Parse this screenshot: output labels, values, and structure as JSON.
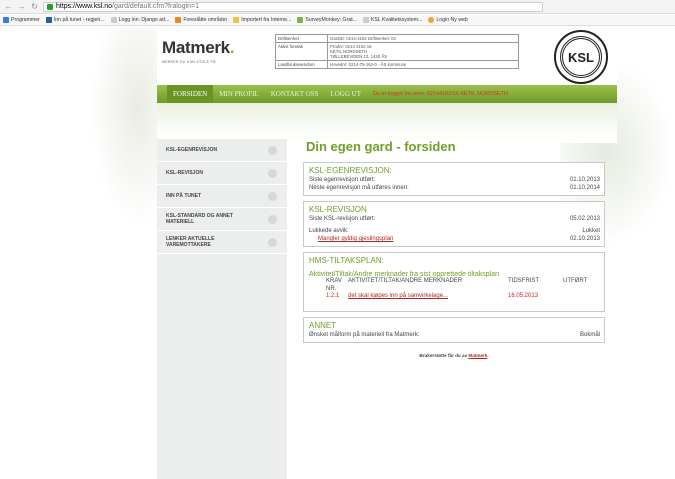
{
  "browser": {
    "url_host": "https://www.ksl.no",
    "url_path": "/gard/default.cfm?fralogin=1",
    "bookmarks": [
      "Programmer",
      "Inn på tunet - regjeri...",
      "Logg inn: Django ad...",
      "Foreslåtte områder",
      "Importert fra Interne...",
      "SurveyMonkey: Grat...",
      "KSL Kvalitetssystem...",
      "Login Ny web"
    ]
  },
  "header": {
    "logo_text": "Matmerk",
    "logo_dot": ".",
    "tagline": "MERKER DU KAN STOLE PÅ",
    "info": [
      {
        "label": "Driftsenhet",
        "value": "GardID: 0214-4162 Driftsenhet: 02"
      },
      {
        "label": "Aktivt foretak",
        "value": "Prodnr: 0214 4162 16\nKETIL NORDSETH\nTØLLEBEVEIEN 12, 1430 ÅS"
      },
      {
        "label": "Landbrukseiendom",
        "value": "Hovednr: 0214-75-162-0 - ÅS kommune"
      }
    ],
    "seal_text": "KSL"
  },
  "nav": {
    "items": [
      "FORSIDEN",
      "MIN PROFIL",
      "KONTAKT OSS",
      "LOGG UT"
    ],
    "logged_in": "Du er logget inn som: 02144162/16 KETIL NORDSETH"
  },
  "sidebar": {
    "items": [
      "KSL-EGENREVISJON",
      "KSL-REVISJON",
      "INN PÅ TUNET",
      "KSL-STANDARD OG ANNET MATERIELL",
      "LENKER AKTUELLE VAREMOTTAKERE"
    ]
  },
  "main": {
    "title": "Din egen gard - forsiden",
    "egen": {
      "title": "KSL-EGENREVISJON:",
      "row1_label": "Siste egenrevisjon utført:",
      "row1_value": "01.10.2013",
      "row2_label": "Neste egenrevisjon må utføres innen:",
      "row2_value": "01.10.2014"
    },
    "rev": {
      "title": "KSL-REVISJON",
      "row1_label": "Siste KSL-revisjon utført:",
      "row1_value": "05.02.2013",
      "row2_label": "Lukkede avvik:",
      "row2_value": "Lukket",
      "link": "Mangler gyldig gjeslingsplan",
      "link_date": "02.10.2013"
    },
    "hms": {
      "title": "HMS-TILTAKSPLAN:",
      "subtitle": "Aktivitet/Tiltak/Andre merknader fra sist opprettede tiltaksplan",
      "cols": [
        "KRAV NR.",
        "AKTIVITET/TILTAK/ANDRE MERKNADER",
        "TIDSFRIST",
        "UTFØRT"
      ],
      "row": [
        "1.2.1",
        "det skal kjøpes inn på samvirkelage...",
        "16.05.2013",
        ""
      ]
    },
    "annet": {
      "title": "ANNET",
      "row_label": "Ønsket målform på materiell fra Matmerk:",
      "row_value": "Bokmål"
    },
    "footer_text": "Brukerstøtte får du av",
    "footer_link": "Matmerk",
    "footer_end": "."
  }
}
